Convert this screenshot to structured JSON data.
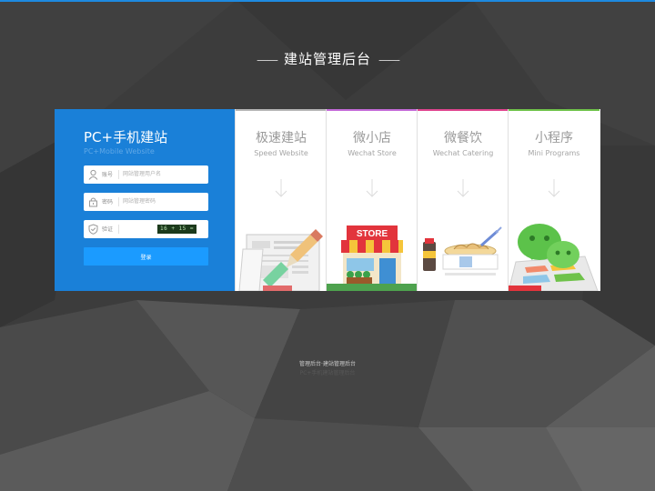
{
  "page": {
    "title": "建站管理后台"
  },
  "login": {
    "title": "PC+手机建站",
    "subtitle": "PC+Mobile Website",
    "username": {
      "label": "账号",
      "placeholder": "网站管理用户名",
      "value": "",
      "icon": "user-icon"
    },
    "password": {
      "label": "密码",
      "placeholder": "网站管理密码",
      "value": "",
      "icon": "lock-icon"
    },
    "captcha": {
      "label": "验证",
      "value": "",
      "code": "16 + 15 =",
      "icon": "shield-icon"
    },
    "submit_label": "登录"
  },
  "panels": [
    {
      "title": "极速建站",
      "subtitle": "Speed Website",
      "accent": "#b5b5b5",
      "icon": "website-editing-icon"
    },
    {
      "title": "微小店",
      "subtitle": "Wechat Store",
      "accent": "#c46bd8",
      "icon": "store-icon"
    },
    {
      "title": "微餐饮",
      "subtitle": "Wechat Catering",
      "accent": "#e0458f",
      "icon": "catering-icon"
    },
    {
      "title": "小程序",
      "subtitle": "Mini Programs",
      "accent": "#6fc24a",
      "icon": "wechat-mini-program-icon"
    }
  ],
  "store_sign": "STORE",
  "footer": {
    "line1": "管理后台·建站管理后台",
    "line2": "PC+手机建站管理后台"
  },
  "colors": {
    "top_line": "#1e8ae0",
    "login_panel": "#1a80d8",
    "login_button": "#1b9bff"
  }
}
